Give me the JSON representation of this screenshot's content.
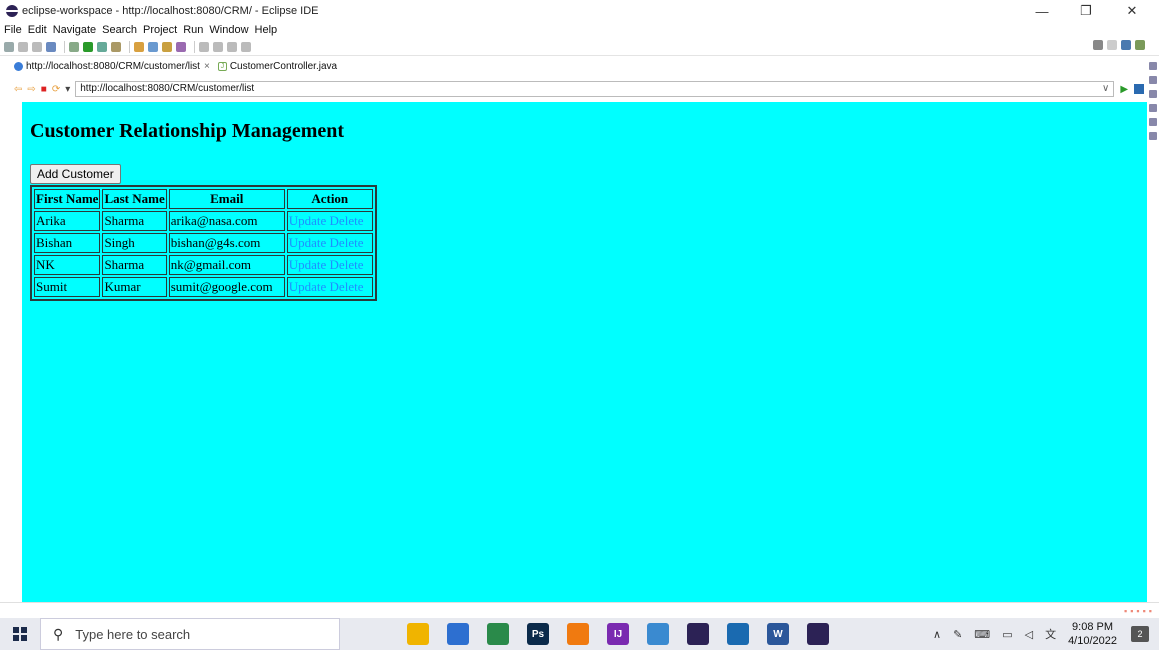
{
  "window": {
    "title": "eclipse-workspace - http://localhost:8080/CRM/ - Eclipse IDE",
    "minimize": "—",
    "maximize": "❐",
    "close": "✕"
  },
  "menu": [
    "File",
    "Edit",
    "Navigate",
    "Search",
    "Project",
    "Run",
    "Window",
    "Help"
  ],
  "tabs": [
    {
      "label": "http://localhost:8080/CRM/customer/list",
      "close": "×"
    },
    {
      "label": "CustomerController.java"
    }
  ],
  "url_bar": {
    "value": "http://localhost:8080/CRM/customer/list",
    "dropdown": "∨"
  },
  "page": {
    "heading": "Customer Relationship Management",
    "add_button": "Add Customer",
    "background": "#00ffff",
    "link_color": "#1e8fff",
    "table": {
      "headers": [
        "First Name",
        "Last Name",
        "Email",
        "Action"
      ],
      "rows": [
        {
          "first": "Arika",
          "last": "Sharma",
          "email": "arika@nasa.com",
          "update": "Update",
          "delete": "Delete"
        },
        {
          "first": "Bishan",
          "last": "Singh",
          "email": "bishan@g4s.com",
          "update": "Update",
          "delete": "Delete"
        },
        {
          "first": "NK",
          "last": "Sharma",
          "email": "nk@gmail.com",
          "update": "Update",
          "delete": "Delete"
        },
        {
          "first": "Sumit",
          "last": "Kumar",
          "email": "sumit@google.com",
          "update": "Update",
          "delete": "Delete"
        }
      ]
    }
  },
  "taskbar": {
    "search_placeholder": "Type here to search",
    "apps": [
      {
        "icon": "file-explorer-icon",
        "glyph": "",
        "color": "#f0b400"
      },
      {
        "icon": "store-icon",
        "glyph": "",
        "color": "#2d6fd0"
      },
      {
        "icon": "chrome-icon",
        "glyph": "",
        "color": "#2a8a4a"
      },
      {
        "icon": "photoshop-icon",
        "glyph": "Ps",
        "color": "#0b2a4a"
      },
      {
        "icon": "vlc-icon",
        "glyph": "",
        "color": "#f07a10"
      },
      {
        "icon": "intellij-icon",
        "glyph": "IJ",
        "color": "#7a2ab0"
      },
      {
        "icon": "git-icon",
        "glyph": "",
        "color": "#3a8ad0"
      },
      {
        "icon": "eclipse-icon",
        "glyph": "",
        "color": "#2c2255"
      },
      {
        "icon": "visual-studio-code-icon",
        "glyph": "",
        "color": "#1a6ab0"
      },
      {
        "icon": "word-icon",
        "glyph": "W",
        "color": "#2b579a"
      },
      {
        "icon": "eclipse-active-icon",
        "glyph": "",
        "color": "#2c2255"
      }
    ],
    "time": "9:08 PM",
    "date": "4/10/2022",
    "notifications": "2"
  }
}
